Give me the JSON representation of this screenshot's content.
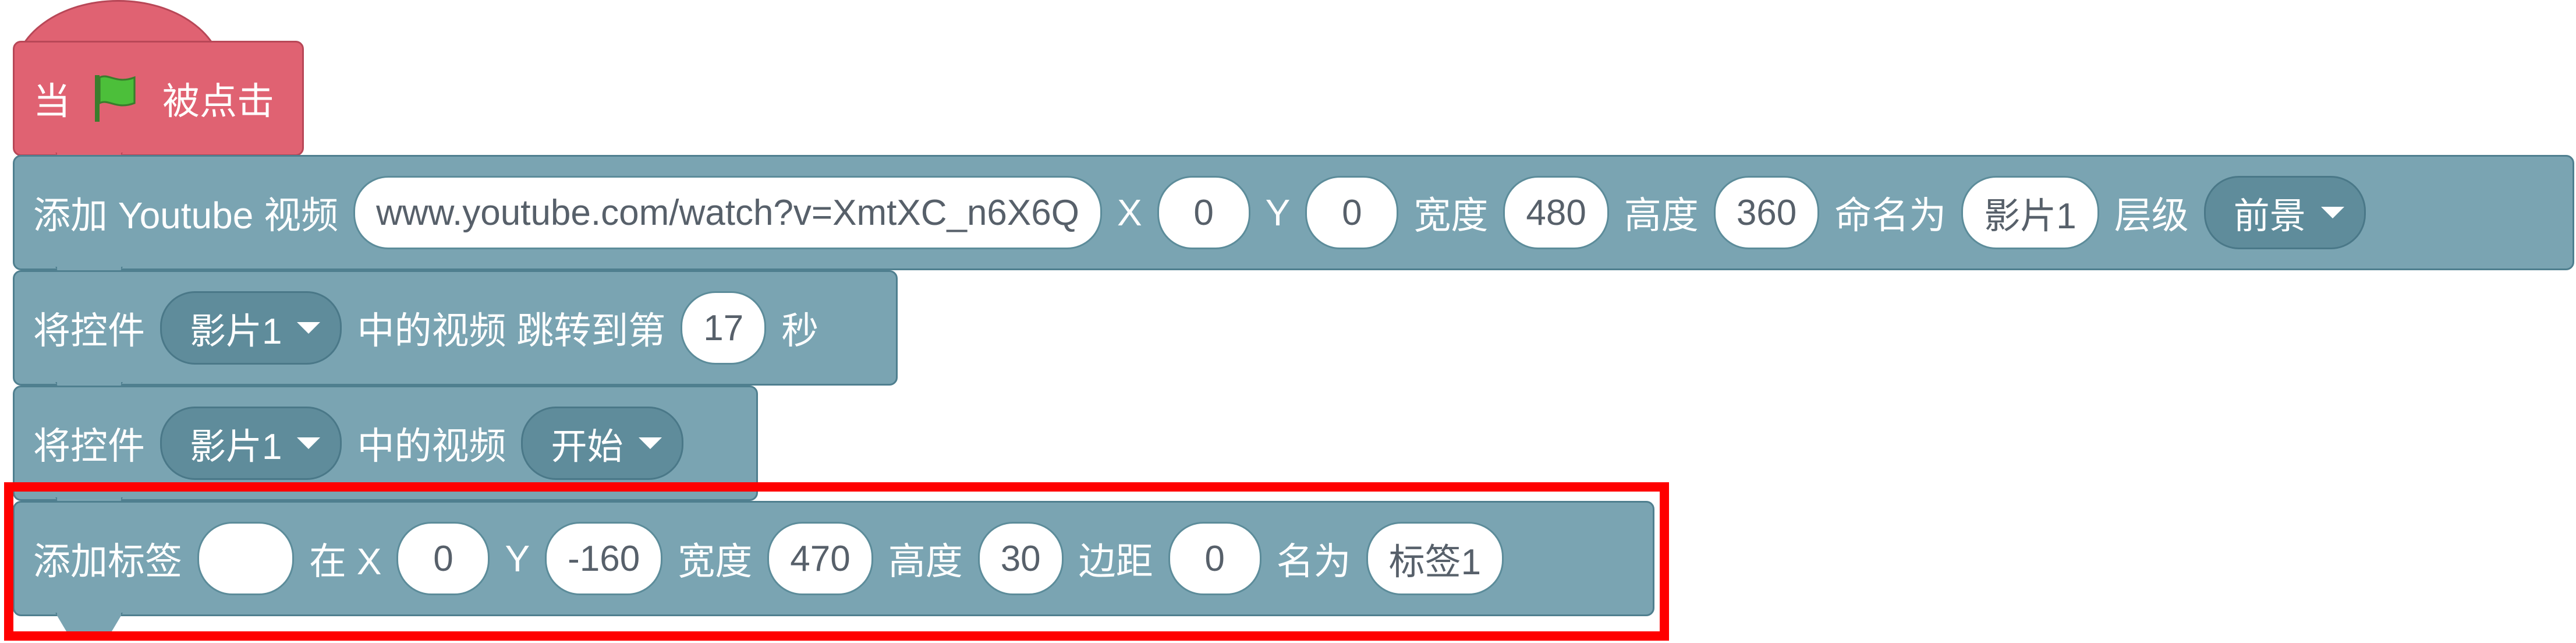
{
  "colors": {
    "event": "#e06272",
    "video": "#7aa4b2",
    "highlight": "#ff0000"
  },
  "hat": {
    "prefix": "当",
    "icon": "green-flag-icon",
    "suffix": "被点击"
  },
  "add_youtube": {
    "label": "添加 Youtube 视频",
    "url": "www.youtube.com/watch?v=XmtXC_n6X6Q",
    "x_label": "X",
    "x": "0",
    "y_label": "Y",
    "y": "0",
    "width_label": "宽度",
    "width": "480",
    "height_label": "高度",
    "height": "360",
    "name_label": "命名为",
    "name": "影片1",
    "layer_label": "层级",
    "layer": "前景"
  },
  "seek": {
    "label": "将控件",
    "widget": "影片1",
    "middle": "中的视频 跳转到第",
    "seconds": "17",
    "unit": "秒"
  },
  "play": {
    "label": "将控件",
    "widget": "影片1",
    "middle": "中的视频",
    "action": "开始"
  },
  "add_label": {
    "label": "添加标签",
    "text": "",
    "at_x_label": "在 X",
    "x": "0",
    "y_label": "Y",
    "y": "-160",
    "width_label": "宽度",
    "width": "470",
    "height_label": "高度",
    "height": "30",
    "margin_label": "边距",
    "margin": "0",
    "name_label": "名为",
    "name": "标签1"
  }
}
